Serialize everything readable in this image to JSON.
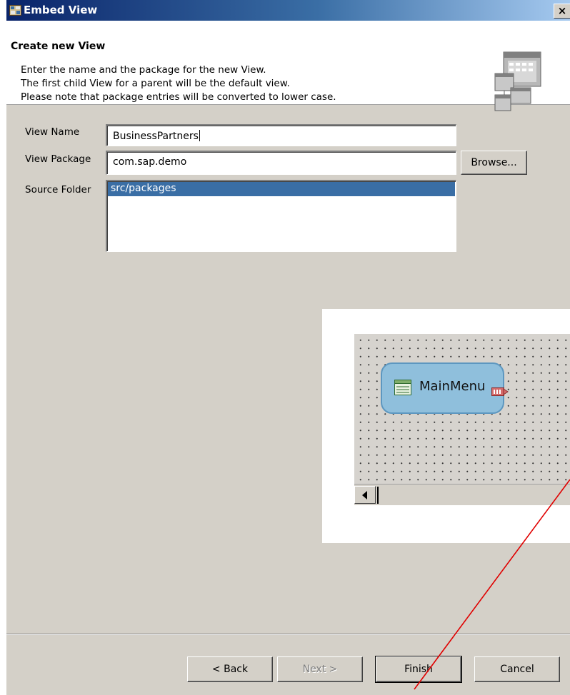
{
  "window": {
    "title": "Embed View",
    "close_label": "×"
  },
  "header": {
    "title": "Create new View",
    "description": [
      "Enter the name and the package for the new View.",
      "The first child View for a parent will be the default view.",
      "Please note that package entries will be converted to lower case."
    ]
  },
  "form": {
    "view_name_label": "View Name",
    "view_name_value": "BusinessPartners",
    "view_package_label": "View Package",
    "view_package_value": "com.sap.demo",
    "browse_label": "Browse...",
    "source_folder_label": "Source Folder",
    "source_folder_items": [
      "src/packages"
    ]
  },
  "overlay": {
    "node_label": "MainMenu"
  },
  "footer": {
    "back_label": "< Back",
    "next_label": "Next >",
    "finish_label": "Finish",
    "cancel_label": "Cancel"
  },
  "colors": {
    "selection": "#3a6ea5",
    "pointer_line": "#e00000",
    "node_fill": "#8fbfdc"
  }
}
